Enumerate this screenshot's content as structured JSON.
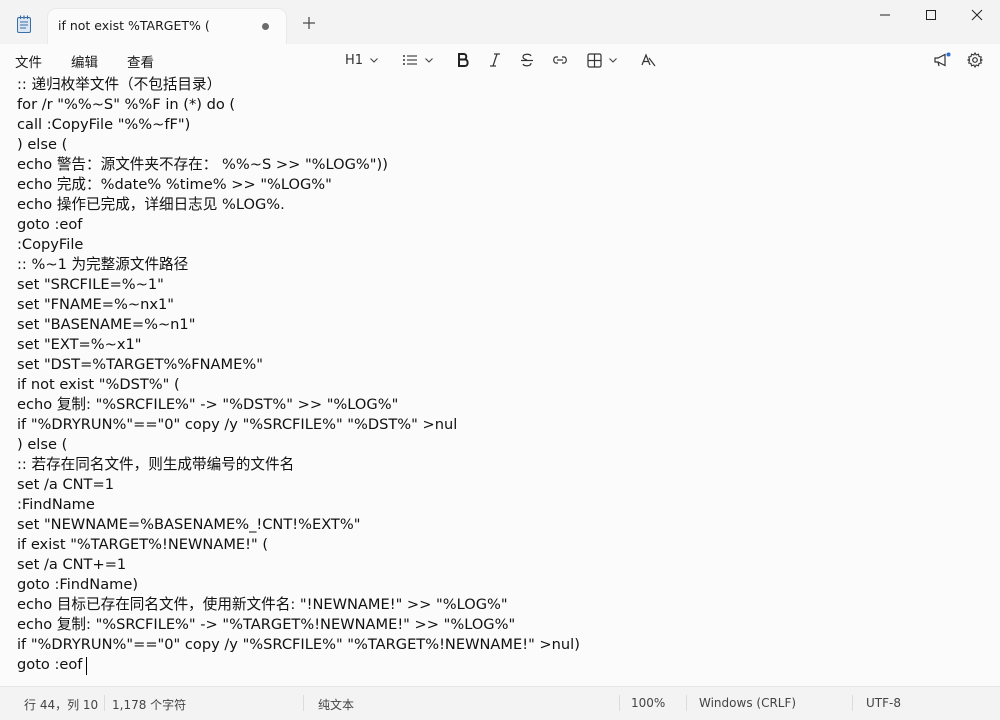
{
  "tab": {
    "title": "if not exist %TARGET% ("
  },
  "window_controls": {
    "minimize": "—",
    "maximize": "☐",
    "close": "✕"
  },
  "menu": {
    "file": "文件",
    "edit": "编辑",
    "view": "查看"
  },
  "toolbar": {
    "heading": "H1"
  },
  "editor": {
    "lines": [
      ":: 递归枚举文件（不包括目录）",
      "for /r \"%%~S\" %%F in (*) do (",
      "call :CopyFile \"%%~fF\")",
      ") else (",
      "echo 警告：源文件夹不存在： %%~S >> \"%LOG%\"))",
      "echo 完成：%date% %time% >> \"%LOG%\"",
      "echo 操作已完成，详细日志见 %LOG%.",
      "goto :eof",
      ":CopyFile",
      ":: %~1 为完整源文件路径",
      "set \"SRCFILE=%~1\"",
      "set \"FNAME=%~nx1\"",
      "set \"BASENAME=%~n1\"",
      "set \"EXT=%~x1\"",
      "set \"DST=%TARGET%%FNAME%\"",
      "if not exist \"%DST%\" (",
      "echo 复制: \"%SRCFILE%\" -> \"%DST%\" >> \"%LOG%\"",
      "if \"%DRYRUN%\"==\"0\" copy /y \"%SRCFILE%\" \"%DST%\" >nul",
      ") else (",
      ":: 若存在同名文件，则生成带编号的文件名",
      "set /a CNT=1",
      ":FindName",
      "set \"NEWNAME=%BASENAME%_!CNT!%EXT%\"",
      "if exist \"%TARGET%!NEWNAME!\" (",
      "set /a CNT+=1",
      "goto :FindName)",
      "echo 目标已存在同名文件，使用新文件名: \"!NEWNAME!\" >> \"%LOG%\"",
      "echo 复制: \"%SRCFILE%\" -> \"%TARGET%!NEWNAME!\" >> \"%LOG%\"",
      "if \"%DRYRUN%\"==\"0\" copy /y \"%SRCFILE%\" \"%TARGET%!NEWNAME!\" >nul)",
      "goto :eof"
    ]
  },
  "status": {
    "position": "行 44，列 10",
    "chars": "1,178 个字符",
    "format": "纯文本",
    "zoom": "100%",
    "line_ending": "Windows (CRLF)",
    "encoding": "UTF-8"
  }
}
